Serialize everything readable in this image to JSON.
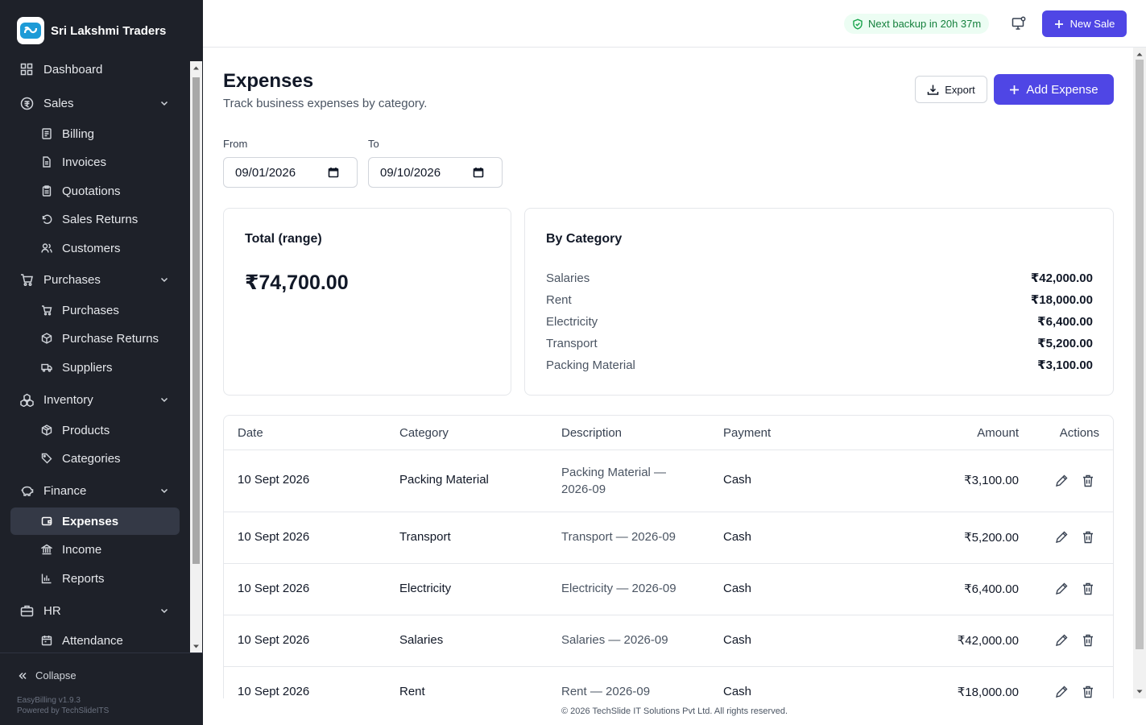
{
  "app": {
    "name": "Sri Lakshmi Traders",
    "version": "EasyBilling v1.9.3",
    "powered_by": "Powered by TechSlideITS",
    "collapse_label": "Collapse",
    "footer": "© 2026 TechSlide IT Solutions Pvt Ltd. All rights reserved."
  },
  "topbar": {
    "backup_status": "Next backup in 20h 37m",
    "new_sale_label": "New Sale"
  },
  "sidebar": {
    "items": [
      {
        "label": "Dashboard",
        "icon": "grid-icon",
        "level": "top"
      },
      {
        "label": "Sales",
        "icon": "currency-icon",
        "level": "top",
        "expandable": true
      },
      {
        "label": "Billing",
        "icon": "receipt-icon",
        "level": "sub"
      },
      {
        "label": "Invoices",
        "icon": "file-icon",
        "level": "sub"
      },
      {
        "label": "Quotations",
        "icon": "clipboard-icon",
        "level": "sub"
      },
      {
        "label": "Sales Returns",
        "icon": "return-icon",
        "level": "sub"
      },
      {
        "label": "Customers",
        "icon": "users-icon",
        "level": "sub"
      },
      {
        "label": "Purchases",
        "icon": "cart-icon",
        "level": "top",
        "expandable": true
      },
      {
        "label": "Purchases",
        "icon": "cart-icon",
        "level": "sub"
      },
      {
        "label": "Purchase Returns",
        "icon": "box-return-icon",
        "level": "sub"
      },
      {
        "label": "Suppliers",
        "icon": "truck-icon",
        "level": "sub"
      },
      {
        "label": "Inventory",
        "icon": "boxes-icon",
        "level": "top",
        "expandable": true
      },
      {
        "label": "Products",
        "icon": "package-icon",
        "level": "sub"
      },
      {
        "label": "Categories",
        "icon": "tag-icon",
        "level": "sub"
      },
      {
        "label": "Finance",
        "icon": "piggy-bank-icon",
        "level": "top",
        "expandable": true
      },
      {
        "label": "Expenses",
        "icon": "wallet-icon",
        "level": "sub",
        "active": true
      },
      {
        "label": "Income",
        "icon": "bank-icon",
        "level": "sub"
      },
      {
        "label": "Reports",
        "icon": "bar-chart-icon",
        "level": "sub"
      },
      {
        "label": "HR",
        "icon": "briefcase-icon",
        "level": "top",
        "expandable": true
      },
      {
        "label": "Attendance",
        "icon": "calendar-icon",
        "level": "sub"
      }
    ]
  },
  "page": {
    "title": "Expenses",
    "subtitle": "Track business expenses by category.",
    "export_label": "Export",
    "add_label": "Add Expense"
  },
  "filters": {
    "from_label": "From",
    "from_value": "09/01/2026",
    "to_label": "To",
    "to_value": "09/10/2026"
  },
  "total_card": {
    "title": "Total (range)",
    "value": "₹74,700.00"
  },
  "category_card": {
    "title": "By Category",
    "rows": [
      {
        "name": "Salaries",
        "amount": "₹42,000.00"
      },
      {
        "name": "Rent",
        "amount": "₹18,000.00"
      },
      {
        "name": "Electricity",
        "amount": "₹6,400.00"
      },
      {
        "name": "Transport",
        "amount": "₹5,200.00"
      },
      {
        "name": "Packing Material",
        "amount": "₹3,100.00"
      }
    ]
  },
  "table": {
    "headers": {
      "date": "Date",
      "category": "Category",
      "description": "Description",
      "payment": "Payment",
      "amount": "Amount",
      "actions": "Actions"
    },
    "rows": [
      {
        "date": "10 Sept 2026",
        "category": "Packing Material",
        "description_line1": "Packing Material —",
        "description_line2": "2026-09",
        "payment": "Cash",
        "amount": "₹3,100.00"
      },
      {
        "date": "10 Sept 2026",
        "category": "Transport",
        "description": "Transport — 2026-09",
        "payment": "Cash",
        "amount": "₹5,200.00"
      },
      {
        "date": "10 Sept 2026",
        "category": "Electricity",
        "description": "Electricity — 2026-09",
        "payment": "Cash",
        "amount": "₹6,400.00"
      },
      {
        "date": "10 Sept 2026",
        "category": "Salaries",
        "description": "Salaries — 2026-09",
        "payment": "Cash",
        "amount": "₹42,000.00"
      },
      {
        "date": "10 Sept 2026",
        "category": "Rent",
        "description": "Rent — 2026-09",
        "payment": "Cash",
        "amount": "₹18,000.00"
      }
    ]
  },
  "colors": {
    "sidebar_bg": "#1e2129",
    "accent": "#4f46e5",
    "backup_green": "#15803d"
  }
}
